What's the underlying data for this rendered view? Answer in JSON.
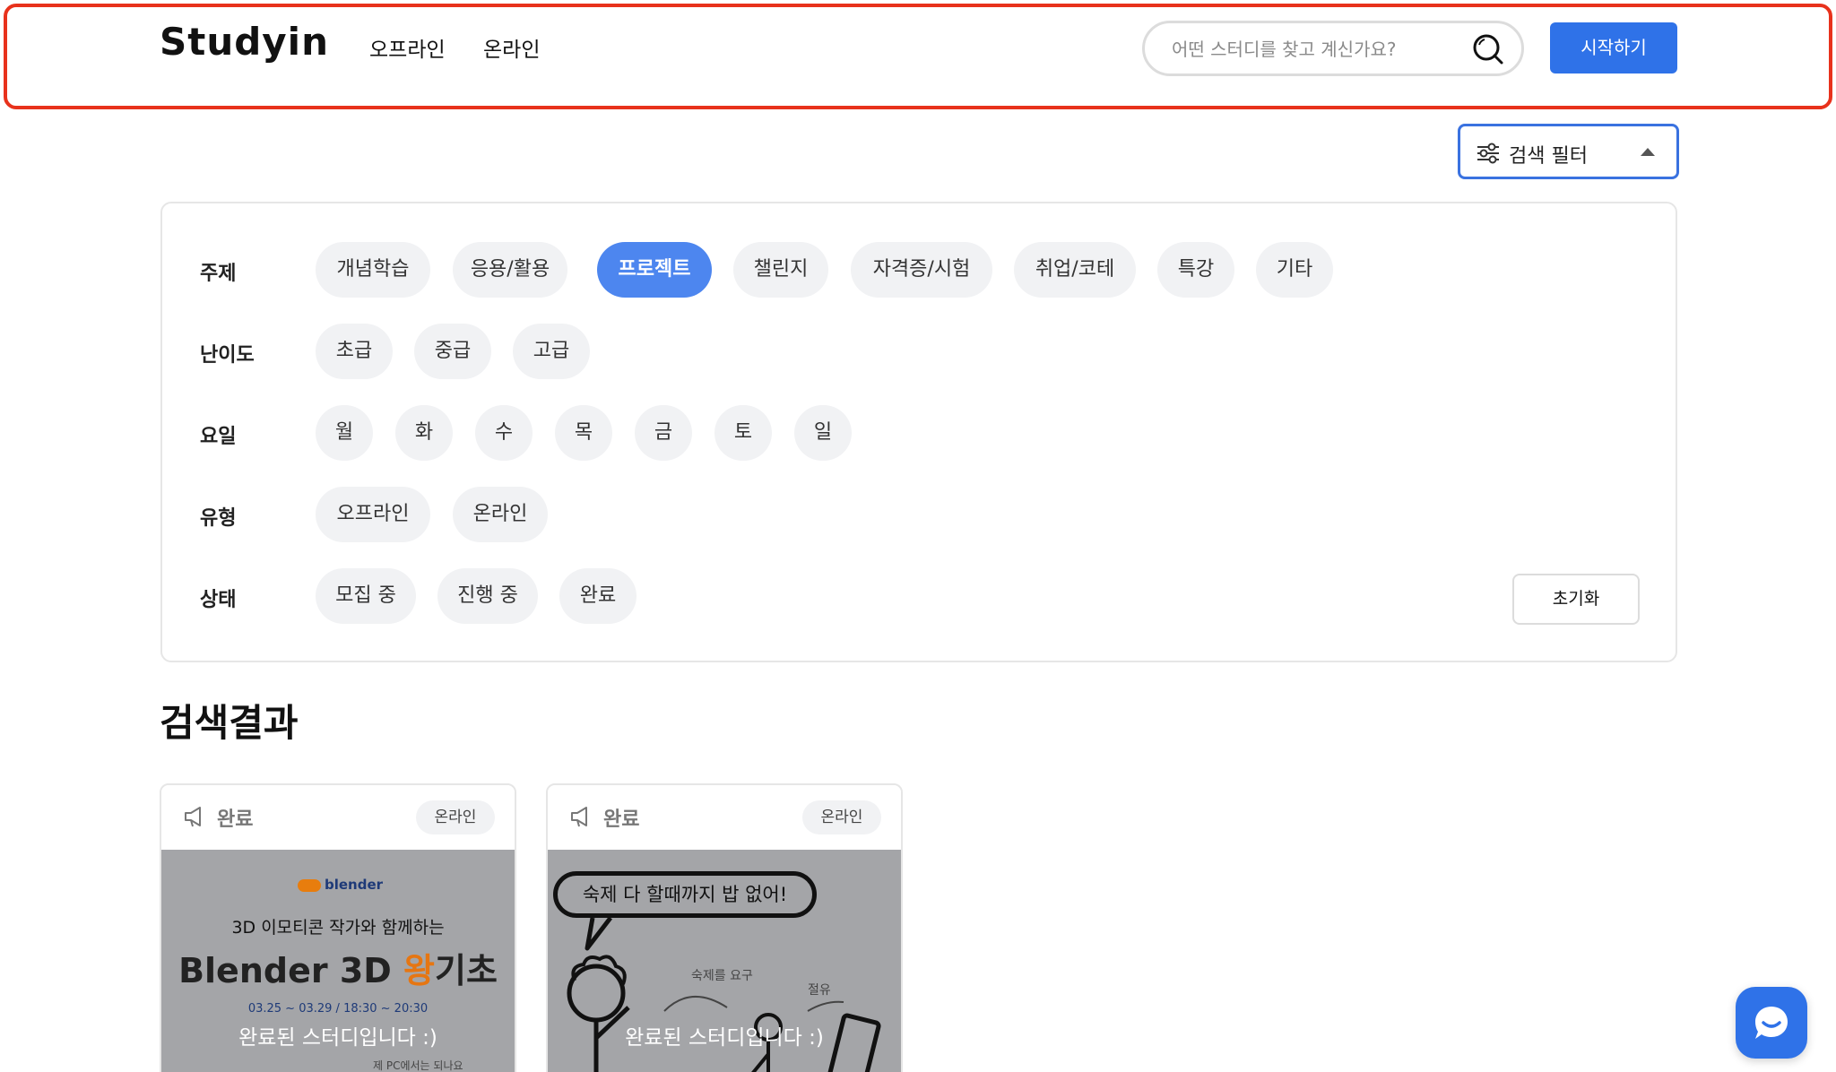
{
  "header": {
    "logo": "Studyin",
    "nav": [
      "오프라인",
      "온라인"
    ],
    "search": {
      "placeholder": "어떤 스터디를 찾고 계신가요?",
      "value": ""
    },
    "start_label": "시작하기"
  },
  "filter_toggle": {
    "label": "검색 필터"
  },
  "filters": {
    "topic": {
      "label": "주제",
      "options": [
        "개념학습",
        "응용/활용",
        "프로젝트",
        "챌린지",
        "자격증/시험",
        "취업/코테",
        "특강",
        "기타"
      ],
      "selected": "프로젝트"
    },
    "level": {
      "label": "난이도",
      "options": [
        "초급",
        "중급",
        "고급"
      ]
    },
    "day": {
      "label": "요일",
      "options": [
        "월",
        "화",
        "수",
        "목",
        "금",
        "토",
        "일"
      ]
    },
    "type": {
      "label": "유형",
      "options": [
        "오프라인",
        "온라인"
      ]
    },
    "status": {
      "label": "상태",
      "options": [
        "모집 중",
        "진행 중",
        "완료"
      ]
    },
    "reset_label": "초기화"
  },
  "results": {
    "heading": "검색결과",
    "cards": [
      {
        "status": "완료",
        "type": "온라인",
        "overlay": "완료된 스터디입니다 :)",
        "thumb": {
          "brand": "blender",
          "subtitle": "3D 이모티콘 작가와 함께하는",
          "title_prefix": "Blender 3D ",
          "title_accent": "왕",
          "title_suffix": "기초",
          "dates": "03.25 ~ 03.29 / 18:30 ~ 20:30",
          "note": "제 PC에서는 되나요"
        }
      },
      {
        "status": "완료",
        "type": "온라인",
        "overlay": "완료된 스터디입니다 :)",
        "thumb": {
          "bubble": "숙제 다 할때까지 밥 없어!",
          "note_1": "숙제를 요구",
          "note_2": "절유"
        }
      }
    ]
  },
  "colors": {
    "accent": "#2f72e8",
    "chip_active": "#4d86ef",
    "outline": "#e8321c",
    "chip_bg": "#f1f2f4"
  },
  "icons": [
    "search-icon",
    "sliders-icon",
    "caret-up-icon",
    "megaphone-icon",
    "chat-icon"
  ]
}
